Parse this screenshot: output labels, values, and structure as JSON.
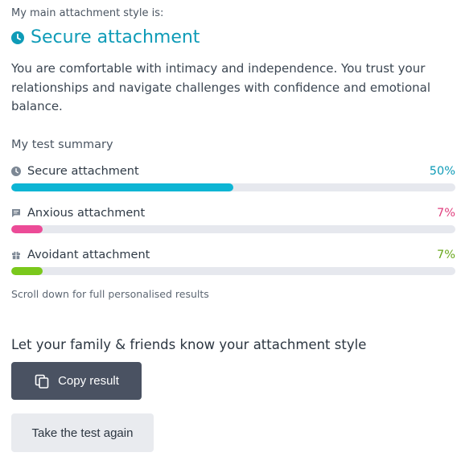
{
  "header": {
    "eyebrow": "My main attachment style is:",
    "title": "Secure attachment",
    "title_icon": "clock-icon",
    "accent_color": "#0e9bb7"
  },
  "description": "You are comfortable with intimacy and independence. You trust your relationships and navigate challenges with confidence and emotional balance.",
  "summary": {
    "title": "My test summary",
    "items": [
      {
        "label": "Secure attachment",
        "percent_text": "50%",
        "percent": 50,
        "icon": "clock-icon",
        "color": "#0db5d4",
        "pct_color": "#0e9bb7"
      },
      {
        "label": "Anxious attachment",
        "percent_text": "7%",
        "percent": 7,
        "icon": "chat-icon",
        "color": "#ec4b97",
        "pct_color": "#e0407f"
      },
      {
        "label": "Avoidant attachment",
        "percent_text": "7%",
        "percent": 7,
        "icon": "gift-icon",
        "color": "#7ac81c",
        "pct_color": "#6aa81e"
      }
    ],
    "note": "Scroll down for full personalised results"
  },
  "share": {
    "title": "Let your family & friends know your attachment style",
    "copy_label": "Copy result",
    "copy_icon": "copy-icon",
    "retake_label": "Take the test again"
  }
}
